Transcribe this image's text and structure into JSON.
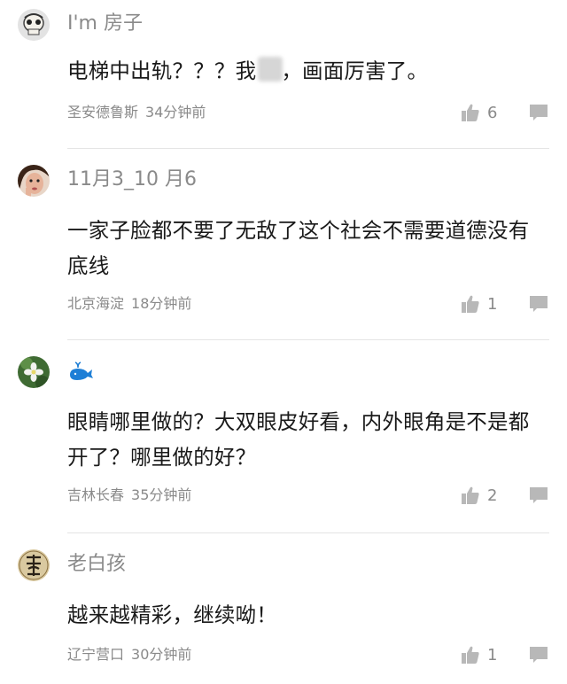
{
  "comments": [
    {
      "username": "I'm 房子",
      "content_pre": "电梯中出轨？？？我",
      "content_post": "，画面厉害了。",
      "location": "圣安德鲁斯",
      "time": "34分钟前",
      "likes": "6",
      "avatar_color": "#cfcfcf"
    },
    {
      "username": "11月3_10 月6",
      "content": "一家子脸都不要了无敌了这个社会不需要道德没有底线",
      "location": "北京海淀",
      "time": "18分钟前",
      "likes": "1",
      "avatar_color": "#b97a5a"
    },
    {
      "username": "",
      "content": "眼睛哪里做的？大双眼皮好看，内外眼角是不是都开了？哪里做的好？",
      "location": "吉林长春",
      "time": "35分钟前",
      "likes": "2",
      "avatar_color": "#4a7a3a",
      "username_icon": "whale-icon"
    },
    {
      "username": "老白孩",
      "content": "越来越精彩，继续呦！",
      "location": "辽宁营口",
      "time": "30分钟前",
      "likes": "1",
      "avatar_color": "#d9c9a0"
    }
  ],
  "colors": {
    "meta": "#8a8a8a",
    "icon": "#b8b8b8",
    "whale": "#1e7fd6"
  }
}
